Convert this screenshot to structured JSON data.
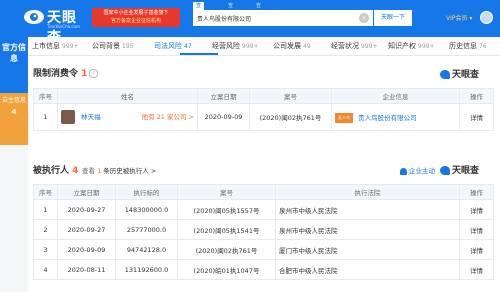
{
  "header": {
    "logo_text": "天眼查",
    "logo_sub": "TianYanCha.com",
    "banner_line1": "国家中小企业发展子基金旗下",
    "banner_line2": "官方备案企业征信机构",
    "search_tabs": [
      "查公司",
      "查老板",
      "查关系"
    ],
    "search_value": "贵人鸟股份有限公司",
    "search_button": "天眼一下",
    "vip_label": "VIP会员 ▾"
  },
  "sidebar": {
    "official_label": "官方信息",
    "self_label": "自主信息",
    "self_count": "4"
  },
  "nav": {
    "tabs": [
      {
        "label": "上市信息",
        "count": "999+"
      },
      {
        "label": "公司背景",
        "count": "195"
      },
      {
        "label": "司法风险",
        "count": "47"
      },
      {
        "label": "经营风险",
        "count": "999+"
      },
      {
        "label": "公司发展",
        "count": "49"
      },
      {
        "label": "经营状况",
        "count": "999+"
      },
      {
        "label": "知识产权",
        "count": "999+"
      },
      {
        "label": "历史信息",
        "count": "76"
      }
    ]
  },
  "restriction": {
    "title": "限制消费令",
    "count": "1",
    "watermark": "天眼查",
    "headers": [
      "序号",
      "姓名",
      "立案日期",
      "案号",
      "企业信息",
      "操作"
    ],
    "rows": [
      {
        "index": "1",
        "name": "林天福",
        "related": "他有 21 家公司 >",
        "date": "2020-09-09",
        "case_no": "(2020)闽02执761号",
        "company": "贵人鸟股份有限公司",
        "action": "详情"
      }
    ]
  },
  "executed": {
    "title": "被执行人",
    "count": "4",
    "note_prefix": "查看",
    "note_count": "1",
    "note_suffix": "条历史被执行人 >",
    "follow_label": "企业主动",
    "watermark": "天眼查",
    "headers": [
      "序号",
      "立案日期",
      "执行标的",
      "案号",
      "执行法院",
      "操作"
    ],
    "rows": [
      {
        "index": "1",
        "date": "2020-09-27",
        "amount": "148300000.0",
        "case_no": "(2020)闽05执1557号",
        "court": "泉州市中级人民法院",
        "action": "详情"
      },
      {
        "index": "2",
        "date": "2020-09-27",
        "amount": "25777000.0",
        "case_no": "(2020)闽05执1541号",
        "court": "泉州市中级人民法院",
        "action": "详情"
      },
      {
        "index": "3",
        "date": "2020-09-09",
        "amount": "94742128.0",
        "case_no": "(2020)闽02执761号",
        "court": "厦门市中级人民法院",
        "action": "详情"
      },
      {
        "index": "4",
        "date": "2020-08-11",
        "amount": "131192600.0",
        "case_no": "(2020)皖01执1047号",
        "court": "合肥市中级人民法院",
        "action": "详情"
      }
    ]
  },
  "colors": {
    "brand": "#1677e8",
    "accent": "#f56b2a",
    "banner": "#e8382c"
  }
}
